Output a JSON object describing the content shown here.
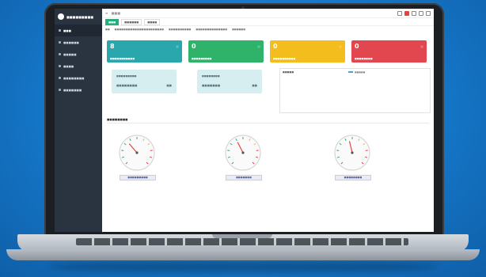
{
  "app": {
    "brand": "■■■■■■■■■",
    "sidebar": [
      {
        "label": "■■■",
        "icon": "menu-icon"
      },
      {
        "label": "■■■■■■",
        "icon": "monitor-icon"
      },
      {
        "label": "■■■■■",
        "icon": "list-icon"
      },
      {
        "label": "■■■■",
        "icon": "gear-icon"
      },
      {
        "label": "■■■■■■■■",
        "icon": "chart-icon"
      },
      {
        "label": "■■■■■■■",
        "icon": "user-icon"
      }
    ],
    "topbar": {
      "menu": "≡",
      "title": "■■■"
    },
    "tabs": [
      {
        "label": "■■■",
        "active": true
      },
      {
        "label": "■■■■■■"
      },
      {
        "label": "■■■■"
      }
    ],
    "breadcrumbs": [
      "■■",
      "■■■■■■■■■■■■■■■■■■■■■■",
      "■■■■■■■■■■",
      "■■■■■■■■■■■■■■",
      "■■■■■■"
    ]
  },
  "cards": [
    {
      "value": "8",
      "label": "■■■■■■■■■■■",
      "color": "#2aa7ad"
    },
    {
      "value": "0",
      "label": "■■■■■■■■■",
      "color": "#2fb36a"
    },
    {
      "value": "0",
      "label": "■■■■■■■■■■",
      "color": "#f2bd1d"
    },
    {
      "value": "0",
      "label": "■■■■■■■■",
      "color": "#e2474f"
    }
  ],
  "mini_cards": [
    {
      "title": "■■■■■■■■■",
      "value": "■■■■■■■■",
      "badge": "■■"
    },
    {
      "title": "■■■■■■■■",
      "value": "■■■■■■■",
      "badge": "■■"
    }
  ],
  "chart": {
    "title": "■■■■■",
    "legend": "■■■■■"
  },
  "gauges_section": {
    "title": "■■■■■■■■"
  },
  "gauges": [
    {
      "label": "■■■■■■■■■",
      "value": 0.35
    },
    {
      "label": "■■■■■■■",
      "value": 0.4
    },
    {
      "label": "■■■■■■■■",
      "value": 0.45
    }
  ]
}
